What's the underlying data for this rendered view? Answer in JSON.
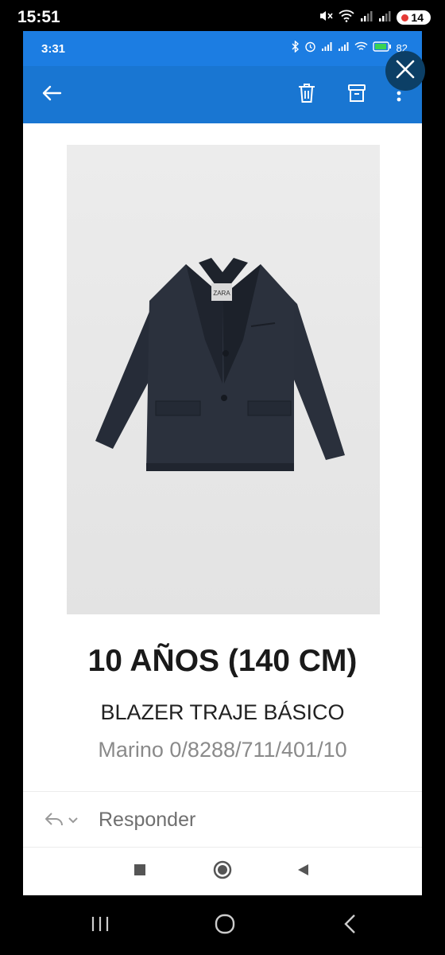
{
  "outer_status": {
    "time": "15:51",
    "battery_badge": "14",
    "icons": [
      "mute-icon",
      "wifi-icon",
      "signal-icon",
      "signal-icon"
    ]
  },
  "inner_status": {
    "time": "3:31",
    "battery": "82",
    "icons": [
      "bluetooth-icon",
      "alarm-icon",
      "signal-icon",
      "signal-icon",
      "wifi-icon",
      "battery-icon"
    ]
  },
  "app_bar": {
    "icons": [
      "back-arrow-icon",
      "trash-icon",
      "archive-icon",
      "more-vert-icon"
    ]
  },
  "product": {
    "size": "10 AÑOS (140 CM)",
    "name": "BLAZER TRAJE BÁSICO",
    "reference": "Marino 0/8288/711/401/10",
    "tag_text": "ZARA"
  },
  "reply": {
    "label": "Responder"
  },
  "colors": {
    "app_bar": "#1976d2",
    "status_bar": "#1c7de2",
    "close_overlay": "#0c3f66",
    "blazer": "#262c38"
  }
}
